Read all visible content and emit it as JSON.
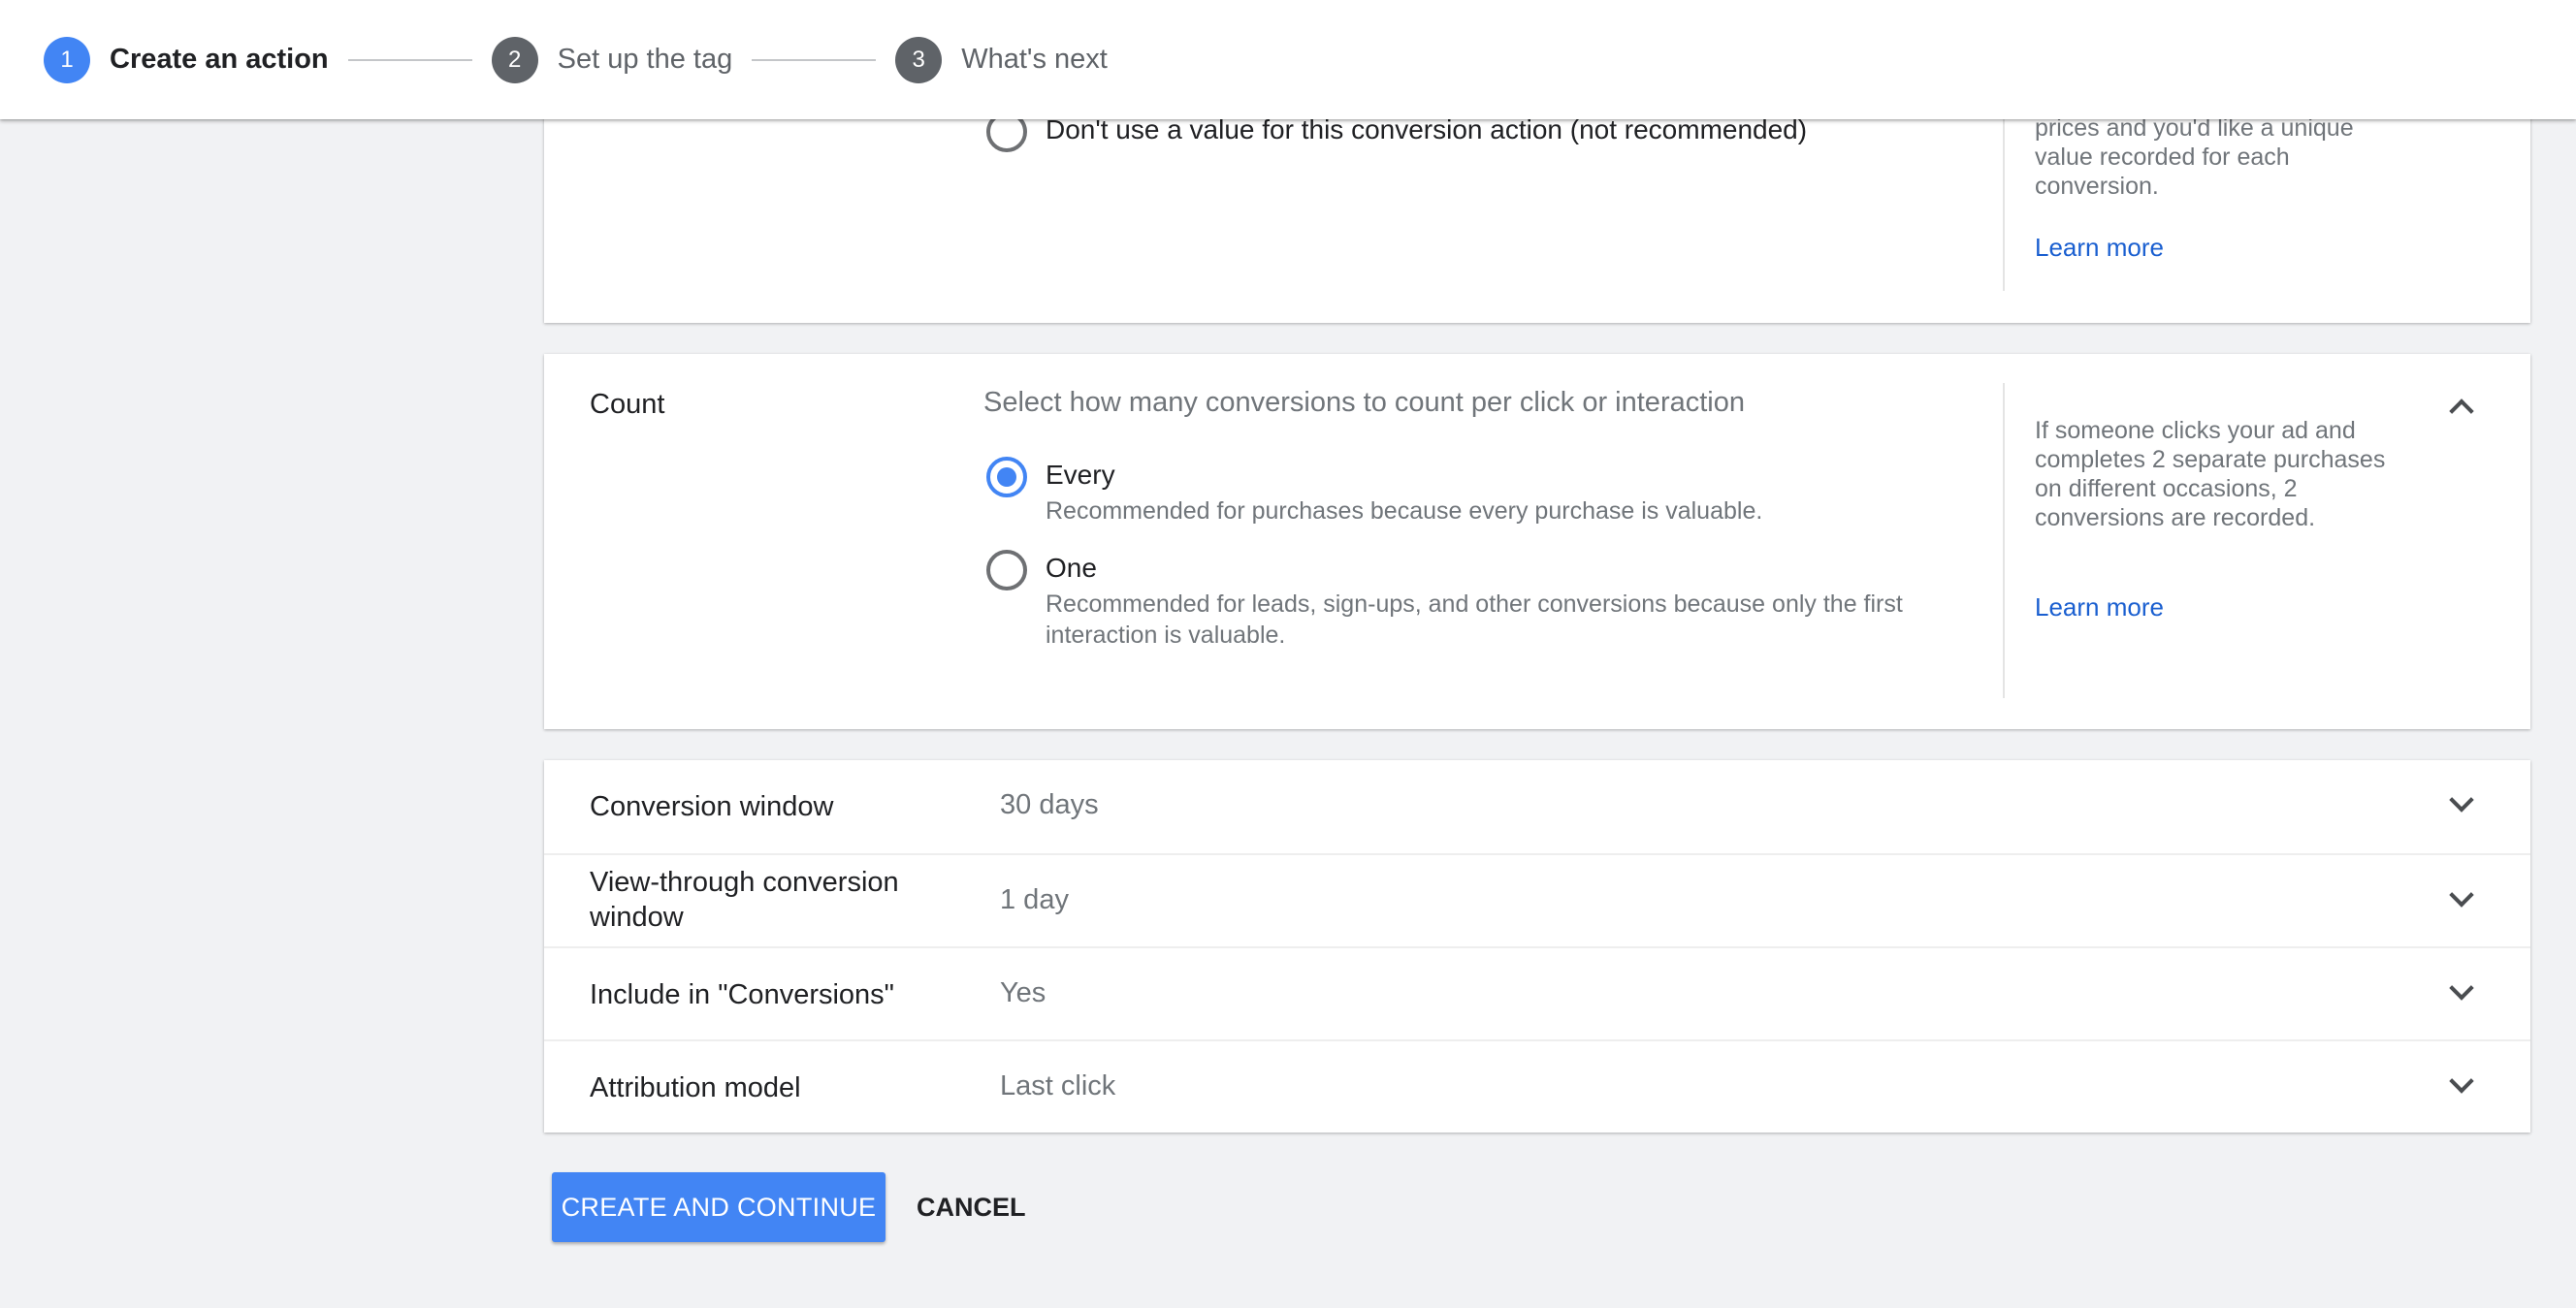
{
  "stepper": {
    "steps": [
      {
        "number": "1",
        "label": "Create an action",
        "state": "active",
        "color": "#4285f4"
      },
      {
        "number": "2",
        "label": "Set up the tag",
        "state": "inactive",
        "color": "#5f6368"
      },
      {
        "number": "3",
        "label": "What's next",
        "state": "inactive",
        "color": "#5f6368"
      }
    ]
  },
  "value_section": {
    "option_no_value": {
      "label": "Don't use a value for this conversion action (not recommended)",
      "selected": false
    },
    "side_text": "prices and you'd like a unique value recorded for each conversion.",
    "learn_more": "Learn more"
  },
  "count_section": {
    "label": "Count",
    "subtitle": "Select how many conversions to count per click or interaction",
    "options": [
      {
        "title": "Every",
        "description": "Recommended for purchases because every purchase is valuable.",
        "selected": true
      },
      {
        "title": "One",
        "description": "Recommended for leads, sign-ups, and other conversions because only the first interaction is valuable.",
        "selected": false
      }
    ],
    "side_text": "If someone clicks your ad and completes 2 separate purchases on different occasions, 2 conversions are recorded.",
    "learn_more": "Learn more",
    "expanded": true
  },
  "settings": [
    {
      "label": "Conversion window",
      "value": "30 days"
    },
    {
      "label": "View-through conversion window",
      "value": "1 day"
    },
    {
      "label": "Include in \"Conversions\"",
      "value": "Yes"
    },
    {
      "label": "Attribution model",
      "value": "Last click"
    }
  ],
  "actions": {
    "primary": "CREATE AND CONTINUE",
    "secondary": "CANCEL"
  },
  "colors": {
    "accent": "#4285f4",
    "link": "#1a5fd0",
    "background": "#f1f2f4"
  },
  "icons": {
    "collapse": "chevron-up-icon",
    "expand": "chevron-down-icon"
  }
}
